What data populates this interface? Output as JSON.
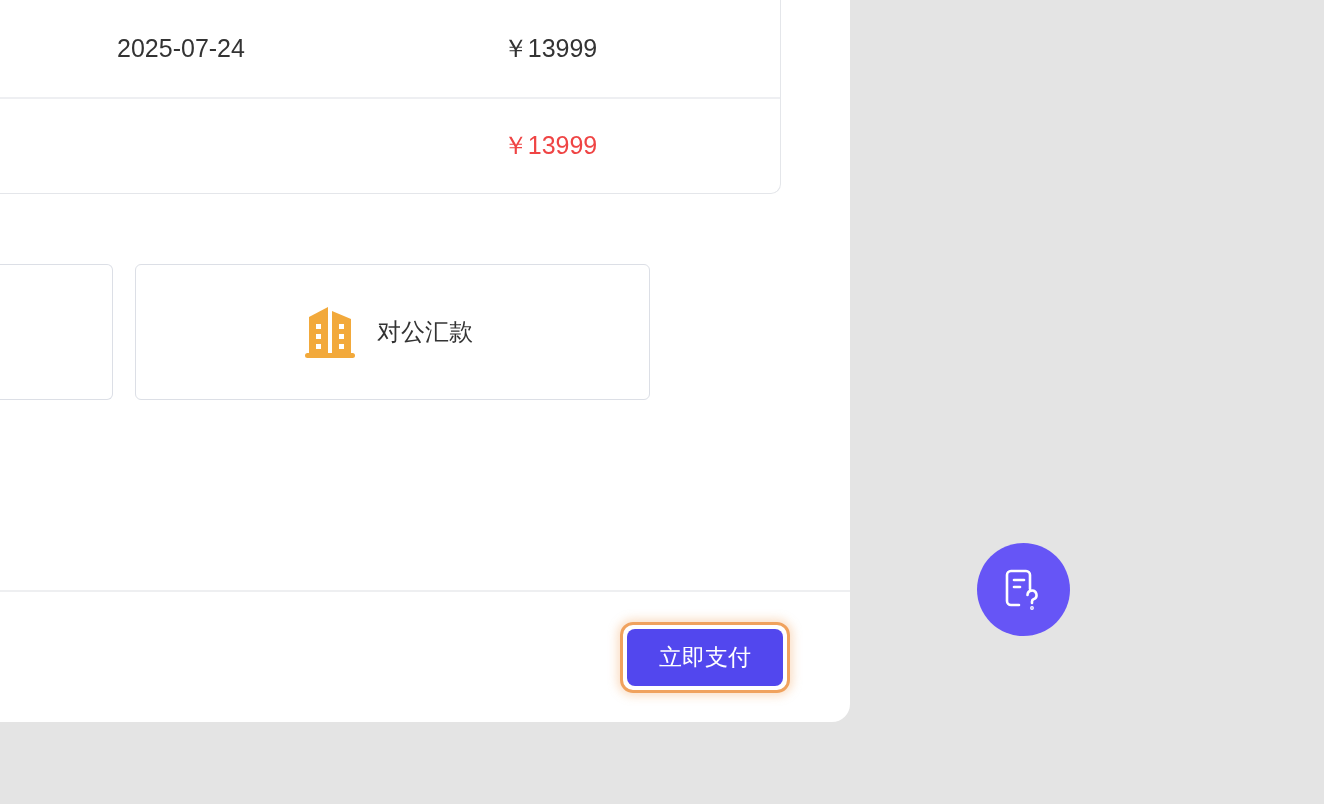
{
  "order_table": {
    "rows": [
      {
        "cells": [
          "2025-07-24",
          "￥13999"
        ]
      }
    ],
    "total": {
      "amount": "￥13999"
    }
  },
  "payment_methods": [
    {
      "selected": false
    },
    {
      "label": "对公汇款",
      "selected": false
    }
  ],
  "footer": {
    "pay_button": {
      "label": "立即支付",
      "focused": true
    }
  }
}
